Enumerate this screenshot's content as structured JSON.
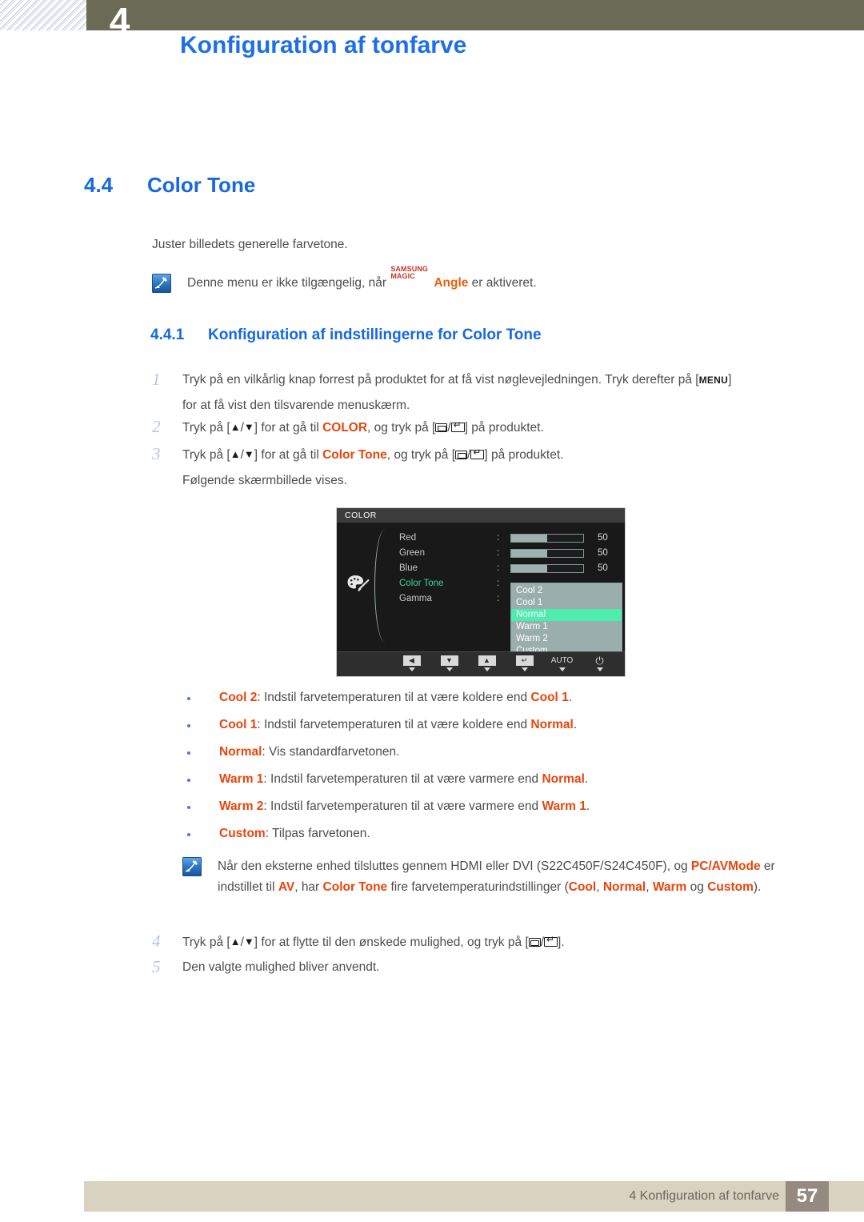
{
  "header": {
    "chapter_number": "4",
    "chapter_title": "Konfiguration af tonfarve"
  },
  "section": {
    "number": "4.4",
    "title": "Color Tone",
    "intro": "Juster billedets generelle farvetone."
  },
  "note1": {
    "text_before": "Denne menu er ikke tilgængelig, når ",
    "brand_top": "SAMSUNG",
    "brand_bottom": "MAGIC",
    "brand_suffix": "Angle",
    "text_after": " er aktiveret."
  },
  "subsection": {
    "number": "4.4.1",
    "title": "Konfiguration af indstillingerne for Color Tone"
  },
  "steps": {
    "step1": {
      "num": "1",
      "part1": "Tryk på en vilkårlig knap forrest på produktet for at få vist nøglevejledningen. Tryk derefter på [",
      "key": "MENU",
      "part2": "]",
      "line2": "for at få vist den tilsvarende menuskærm."
    },
    "step2": {
      "num": "2",
      "part1": "Tryk på [",
      "part2": "] for at gå til ",
      "highlight": "COLOR",
      "part3": ", og tryk på [",
      "part4": "] på produktet."
    },
    "step3": {
      "num": "3",
      "part1": "Tryk på [",
      "part2": "] for at gå til ",
      "highlight": "Color Tone",
      "part3": ", og tryk på [",
      "part4": "] på produktet.",
      "line2": "Følgende skærmbillede vises."
    },
    "step4": {
      "num": "4",
      "part1": "Tryk på [",
      "part2": "] for at flytte til den ønskede mulighed, og tryk på [",
      "part3": "]."
    },
    "step5": {
      "num": "5",
      "text": "Den valgte mulighed bliver anvendt."
    }
  },
  "osd": {
    "title": "COLOR",
    "rows": [
      {
        "label": "Red",
        "colon": ":",
        "value": "50",
        "fill": 50,
        "type": "slider",
        "active": false
      },
      {
        "label": "Green",
        "colon": ":",
        "value": "50",
        "fill": 50,
        "type": "slider",
        "active": false
      },
      {
        "label": "Blue",
        "colon": ":",
        "value": "50",
        "fill": 50,
        "type": "slider",
        "active": false
      },
      {
        "label": "Color Tone",
        "colon": ":",
        "value": "",
        "fill": 0,
        "type": "list",
        "active": true
      },
      {
        "label": "Gamma",
        "colon": ":",
        "value": "",
        "fill": 0,
        "type": "none",
        "active": false
      }
    ],
    "dropdown": {
      "options": [
        "Cool 2",
        "Cool 1",
        "Normal",
        "Warm 1",
        "Warm 2",
        "Custom"
      ],
      "selected": "Normal"
    },
    "buttons": [
      {
        "name": "left",
        "glyph": "◀",
        "kind": "cap"
      },
      {
        "name": "down",
        "glyph": "▼",
        "kind": "cap"
      },
      {
        "name": "up",
        "glyph": "▲",
        "kind": "cap"
      },
      {
        "name": "enter",
        "glyph": "↵",
        "kind": "cap"
      },
      {
        "name": "auto",
        "glyph": "AUTO",
        "kind": "text"
      },
      {
        "name": "power",
        "glyph": "⏻",
        "kind": "pwr"
      }
    ],
    "colors": {
      "background": "#191919",
      "titlebar": "#3c3c3c",
      "slider_fill": "#9fb0b0",
      "dropdown_bg": "#9aaeae",
      "selected_bg": "#4dedad",
      "active_label": "#3fd49b"
    }
  },
  "bullets": [
    {
      "term": "Cool 2",
      "rest": ": Indstil farvetemperaturen til at være koldere end ",
      "ref": "Cool 1",
      "tail": "."
    },
    {
      "term": "Cool 1",
      "rest": ": Indstil farvetemperaturen til at være koldere end ",
      "ref": "Normal",
      "tail": "."
    },
    {
      "term": "Normal",
      "rest": ": Vis standardfarvetonen.",
      "ref": "",
      "tail": ""
    },
    {
      "term": "Warm 1",
      "rest": ": Indstil farvetemperaturen til at være varmere end ",
      "ref": "Normal",
      "tail": "."
    },
    {
      "term": "Warm 2",
      "rest": ": Indstil farvetemperaturen til at være varmere end ",
      "ref": "Warm 1",
      "tail": "."
    },
    {
      "term": "Custom",
      "rest": ": Tilpas farvetonen.",
      "ref": "",
      "tail": ""
    }
  ],
  "note2": {
    "l1_a": "Når den eksterne enhed tilsluttes gennem HDMI eller DVI (S22C450F/S24C450F), og ",
    "l1_b": "PC/AV",
    "l2_a": "Mode",
    "l2_b": " er indstillet til ",
    "l2_c": "AV",
    "l2_d": ", har ",
    "l2_e": "Color Tone",
    "l2_f": " fire farvetemperaturindstillinger (",
    "l2_g": "Cool",
    "l2_h": ", ",
    "l2_i": "Normal",
    "l2_j": ", ",
    "l2_k": "Warm",
    "l2_l": " og",
    "l3_a": "Custom",
    "l3_b": ")."
  },
  "footer": {
    "text": "4 Konfiguration af tonfarve",
    "page": "57"
  },
  "theme": {
    "heading_blue": "#1769e0",
    "highlight_orange": "#e8450d",
    "header_olive": "#6b6a54",
    "footer_beige": "#d8d2c0",
    "footer_page_bg": "#958a80",
    "bullet_blue": "#4a78d6",
    "step_num_color": "#b9c4e8"
  }
}
